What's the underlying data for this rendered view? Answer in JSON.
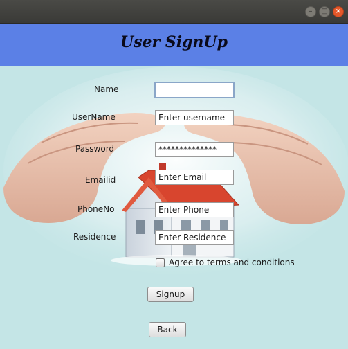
{
  "header": {
    "title": "User SignUp"
  },
  "form": {
    "name": {
      "label": "Name",
      "value": ""
    },
    "username": {
      "label": "UserName",
      "value": "Enter username"
    },
    "password": {
      "label": "Password",
      "value": "**************"
    },
    "email": {
      "label": "Emailid",
      "value": "Enter Email"
    },
    "phone": {
      "label": "PhoneNo",
      "value": "Enter Phone"
    },
    "residence": {
      "label": "Residence",
      "value": "Enter Residence"
    },
    "terms": {
      "label": "Agree to terms and conditions",
      "checked": false
    }
  },
  "buttons": {
    "signup": "Signup",
    "back": "Back"
  },
  "window_controls": {
    "minimize": "–",
    "maximize": "□",
    "close": "×"
  },
  "colors": {
    "header": "#5b80e6",
    "background": "#c4e5e6",
    "roof": "#d8452e",
    "close": "#e5582a"
  }
}
